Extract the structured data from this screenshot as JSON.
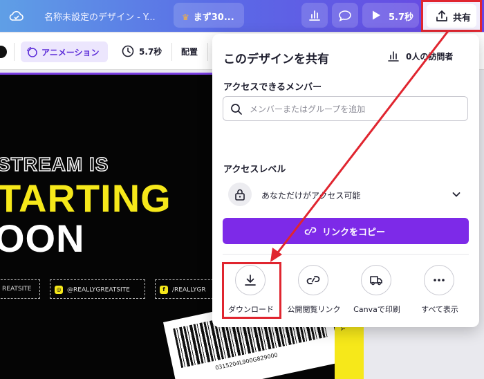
{
  "topbar": {
    "doc_title": "名称未設定のデザイン - Y...",
    "trial_label": "まず30...",
    "play_label": "5.7秒",
    "share_label": "共有"
  },
  "toolbar": {
    "animation_label": "アニメーション",
    "duration_label": "5.7秒",
    "arrange_label": "配置"
  },
  "design": {
    "line1": "STREAM IS",
    "line2": "TARTING",
    "line3": "OON",
    "social": [
      "REATSITE",
      "@REALLYGREATSITE",
      "/REALLYGR"
    ],
    "barcode_number": "0315204L900G829000",
    "side_text": "YOUR"
  },
  "share_panel": {
    "title": "このデザインを共有",
    "visitors": "0人の訪問者",
    "members_label": "アクセスできるメンバー",
    "search_placeholder": "メンバーまたはグループを追加",
    "access_level_label": "アクセスレベル",
    "access_value": "あなただけがアクセス可能",
    "copy_link_label": "リンクをコピー",
    "actions": [
      {
        "label": "ダウンロード",
        "icon": "download-icon"
      },
      {
        "label": "公開閲覧リンク",
        "icon": "link-icon"
      },
      {
        "label": "Canvaで印刷",
        "icon": "truck-icon"
      },
      {
        "label": "すべて表示",
        "icon": "more-icon"
      }
    ]
  },
  "colors": {
    "accent_purple": "#7d2ae8",
    "highlight_red": "#e0252f",
    "design_yellow": "#f6e81a"
  }
}
